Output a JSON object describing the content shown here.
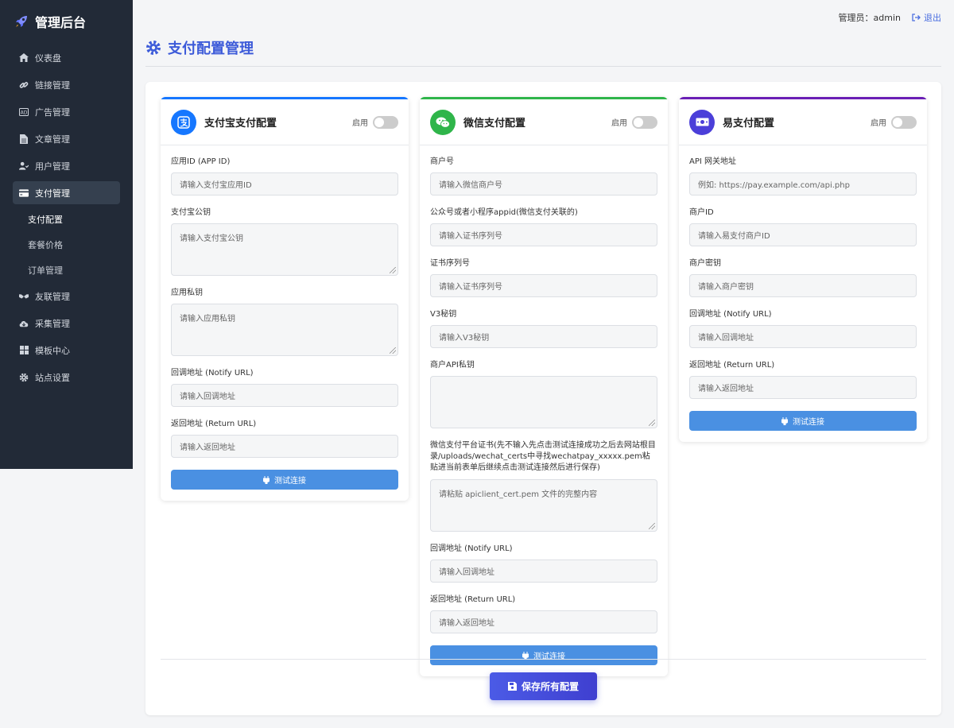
{
  "brand": {
    "title": "管理后台",
    "icon": "rocket-icon"
  },
  "sidebar": {
    "items": [
      {
        "label": "仪表盘",
        "icon": "dashboard-icon"
      },
      {
        "label": "链接管理",
        "icon": "link-icon"
      },
      {
        "label": "广告管理",
        "icon": "ad-icon"
      },
      {
        "label": "文章管理",
        "icon": "file-icon"
      },
      {
        "label": "用户管理",
        "icon": "users-icon"
      },
      {
        "label": "支付管理",
        "icon": "credit-card-icon",
        "active": true
      },
      {
        "label": "友联管理",
        "icon": "handshake-icon"
      },
      {
        "label": "采集管理",
        "icon": "cloud-download-icon"
      },
      {
        "label": "模板中心",
        "icon": "grid-icon"
      },
      {
        "label": "站点设置",
        "icon": "gear-icon"
      }
    ],
    "sub_items": [
      {
        "label": "支付配置",
        "active": true
      },
      {
        "label": "套餐价格"
      },
      {
        "label": "订单管理"
      }
    ]
  },
  "topbar": {
    "admin": "管理员：admin",
    "logout": "退出"
  },
  "page": {
    "title": "支付配置管理",
    "icon": "gear-icon"
  },
  "alipay": {
    "title": "支付宝支付配置",
    "enable_label": "启用",
    "color": "#1677ff",
    "fields": {
      "appid_label": "应用ID (APP ID)",
      "appid_ph": "请输入支付宝应用ID",
      "pubkey_label": "支付宝公钥",
      "pubkey_ph": "请输入支付宝公钥",
      "privkey_label": "应用私钥",
      "privkey_ph": "请输入应用私钥",
      "notify_label": "回调地址 (Notify URL)",
      "notify_ph": "请输入回调地址",
      "return_label": "返回地址 (Return URL)",
      "return_ph": "请输入返回地址"
    },
    "test_btn": "测试连接"
  },
  "wechat": {
    "title": "微信支付配置",
    "enable_label": "启用",
    "color": "#2fb54a",
    "fields": {
      "mchid_label": "商户号",
      "mchid_ph": "请输入微信商户号",
      "appid_label": "公众号或者小程序appid(微信支付关联的)",
      "appid_ph": "请输入证书序列号",
      "serial_label": "证书序列号",
      "serial_ph": "请输入证书序列号",
      "v3_label": "V3秘钥",
      "v3_ph": "请输入V3秘钥",
      "apikey_label": "商户API私钥",
      "apikey_ph": "",
      "cert_label": "微信支付平台证书(先不输入先点击测试连接成功之后去网站根目录/uploads/wechat_certs中寻找wechatpay_xxxxx.pem粘贴进当前表单后继续点击测试连接然后进行保存)",
      "cert_ph": "请粘贴 apiclient_cert.pem 文件的完整内容",
      "notify_label": "回调地址 (Notify URL)",
      "notify_ph": "请输入回调地址",
      "return_label": "返回地址 (Return URL)",
      "return_ph": "请输入返回地址"
    },
    "test_btn": "测试连接"
  },
  "epay": {
    "title": "易支付配置",
    "enable_label": "启用",
    "color": "#6a1fb5",
    "fields": {
      "gateway_label": "API 网关地址",
      "gateway_ph": "例如: https://pay.example.com/api.php",
      "pid_label": "商户ID",
      "pid_ph": "请输入易支付商户ID",
      "key_label": "商户密钥",
      "key_ph": "请输入商户密钥",
      "notify_label": "回调地址 (Notify URL)",
      "notify_ph": "请输入回调地址",
      "return_label": "返回地址 (Return URL)",
      "return_ph": "请输入返回地址"
    },
    "test_btn": "测试连接"
  },
  "save_btn": "保存所有配置"
}
